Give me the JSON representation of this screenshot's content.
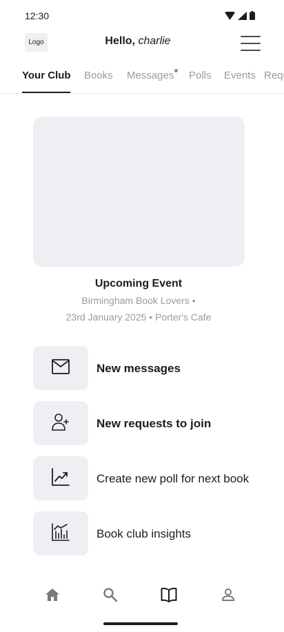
{
  "status": {
    "time": "12:30"
  },
  "header": {
    "logo": "Logo",
    "greeting": "Hello,",
    "user_name": "charlie"
  },
  "tabs": [
    {
      "label": "Your  Club",
      "active": true
    },
    {
      "label": "Books"
    },
    {
      "label": "Messages",
      "badge": true
    },
    {
      "label": "Polls"
    },
    {
      "label": "Events"
    },
    {
      "label": "Requ"
    }
  ],
  "event": {
    "title": "Upcoming Event",
    "line1": "Birmingham Book Lovers •",
    "line2": "23rd January 2025 • Porter's Cafe"
  },
  "actions": [
    {
      "label": "New messages",
      "icon": "mail-icon",
      "bold": true
    },
    {
      "label": "New requests to join",
      "icon": "add-user-icon",
      "bold": true
    },
    {
      "label": "Create new poll for next book",
      "icon": "trend-chart-icon",
      "bold": false
    },
    {
      "label": "Book club insights",
      "icon": "bar-chart-icon",
      "bold": false
    }
  ],
  "bottom_nav": [
    {
      "icon": "home-icon",
      "active": false
    },
    {
      "icon": "search-icon",
      "active": false
    },
    {
      "icon": "book-icon",
      "active": true
    },
    {
      "icon": "profile-icon",
      "active": false
    }
  ],
  "colors": {
    "accent": "#1c1c1e",
    "muted": "#9a9aa0",
    "surface": "#efeff3"
  }
}
